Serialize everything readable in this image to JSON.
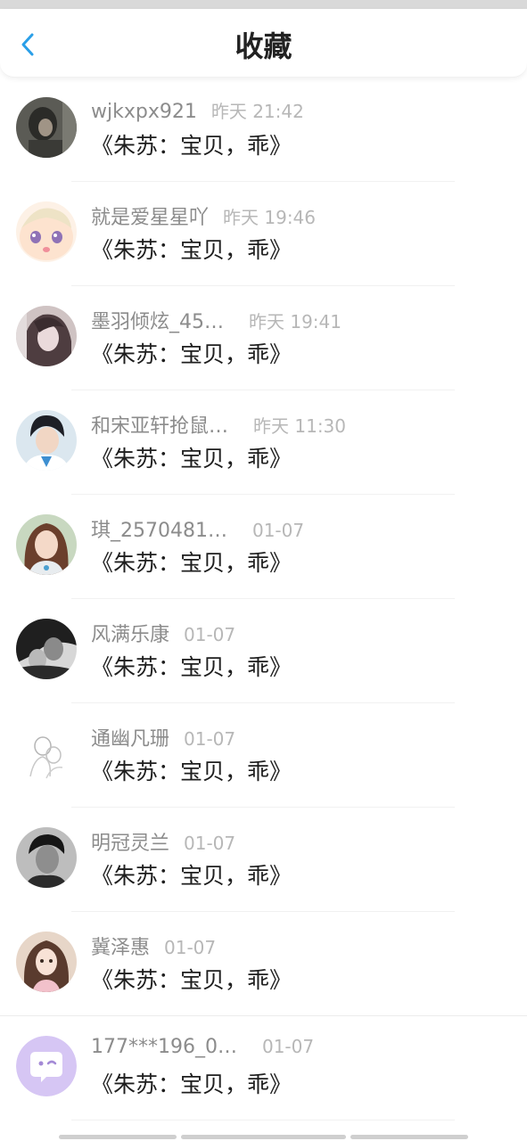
{
  "header": {
    "title": "收藏",
    "back_icon": "chevron-left-icon",
    "accent_color": "#2a9fe8"
  },
  "items": [
    {
      "name": "wjkxpx921",
      "time": "昨天 21:42",
      "message": "《朱苏：宝贝，乖》"
    },
    {
      "name": "就是爱星星吖",
      "time": "昨天 19:46",
      "message": "《朱苏：宝贝，乖》"
    },
    {
      "name": "墨羽倾炫_45…",
      "time": "昨天 19:41",
      "message": "《朱苏：宝贝，乖》"
    },
    {
      "name": "和宋亚轩抢鼠…",
      "time": "昨天 11:30",
      "message": "《朱苏：宝贝，乖》"
    },
    {
      "name": "琪_2570481…",
      "time": "01-07",
      "message": "《朱苏：宝贝，乖》"
    },
    {
      "name": "风满乐康",
      "time": "01-07",
      "message": "《朱苏：宝贝，乖》"
    },
    {
      "name": "通幽凡珊",
      "time": "01-07",
      "message": "《朱苏：宝贝，乖》"
    },
    {
      "name": "明冠灵兰",
      "time": "01-07",
      "message": "《朱苏：宝贝，乖》"
    },
    {
      "name": "冀泽惠",
      "time": "01-07",
      "message": "《朱苏：宝贝，乖》"
    },
    {
      "name": "177***196_0…",
      "time": "01-07",
      "message": "《朱苏：宝贝，乖》"
    }
  ]
}
